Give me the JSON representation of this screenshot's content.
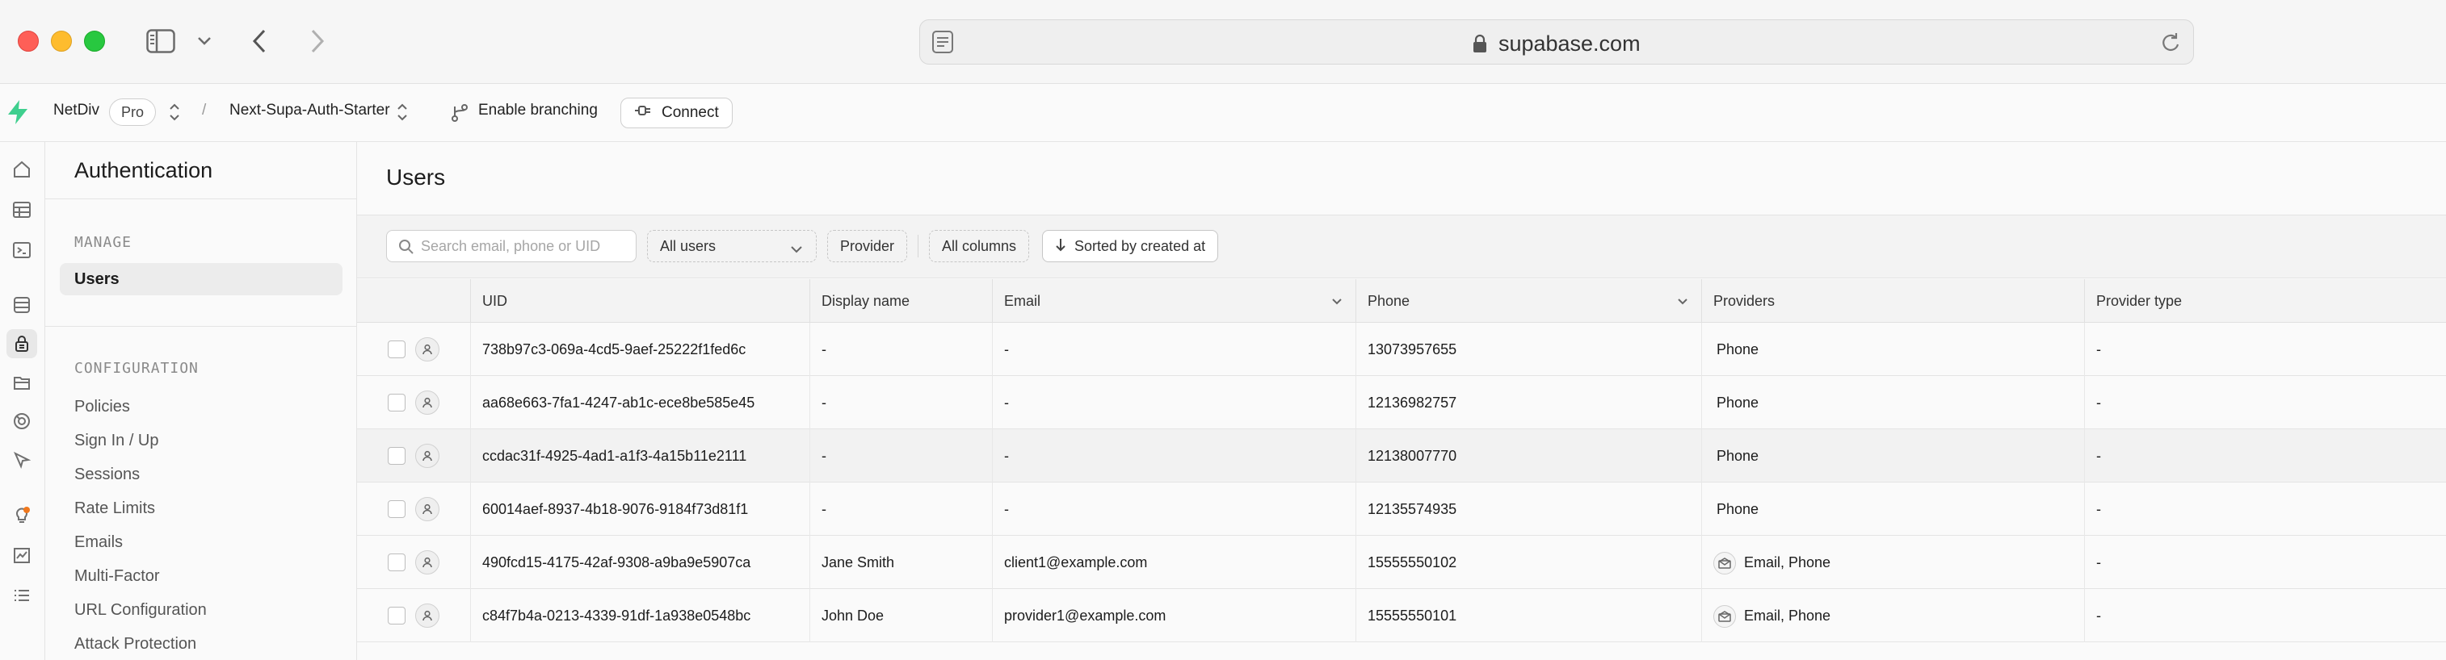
{
  "browser": {
    "url": "supabase.com"
  },
  "header": {
    "org_name": "NetDiv",
    "plan_badge": "Pro",
    "separator": "/",
    "project_name": "Next-Supa-Auth-Starter",
    "branching_label": "Enable branching",
    "connect_label": "Connect"
  },
  "sidebar": {
    "title": "Authentication",
    "manage_heading": "MANAGE",
    "manage_items": [
      {
        "label": "Users"
      }
    ],
    "config_heading": "CONFIGURATION",
    "config_items": [
      {
        "label": "Policies"
      },
      {
        "label": "Sign In / Up"
      },
      {
        "label": "Sessions"
      },
      {
        "label": "Rate Limits"
      },
      {
        "label": "Emails"
      },
      {
        "label": "Multi-Factor"
      },
      {
        "label": "URL Configuration"
      },
      {
        "label": "Attack Protection"
      }
    ]
  },
  "main": {
    "title": "Users",
    "toolbar": {
      "search_placeholder": "Search email, phone or UID",
      "user_filter": "All users",
      "provider_label": "Provider",
      "columns_label": "All columns",
      "sort_label": "Sorted by created at"
    },
    "table": {
      "columns": [
        "UID",
        "Display name",
        "Email",
        "Phone",
        "Providers",
        "Provider type"
      ],
      "rows": [
        {
          "uid": "738b97c3-069a-4cd5-9aef-25222f1fed6c",
          "display_name": "-",
          "email": "-",
          "phone": "13073957655",
          "providers": "Phone",
          "provider_type": "-"
        },
        {
          "uid": "aa68e663-7fa1-4247-ab1c-ece8be585e45",
          "display_name": "-",
          "email": "-",
          "phone": "12136982757",
          "providers": "Phone",
          "provider_type": "-"
        },
        {
          "uid": "ccdac31f-4925-4ad1-a1f3-4a15b11e2111",
          "display_name": "-",
          "email": "-",
          "phone": "12138007770",
          "providers": "Phone",
          "provider_type": "-"
        },
        {
          "uid": "60014aef-8937-4b18-9076-9184f73d81f1",
          "display_name": "-",
          "email": "-",
          "phone": "12135574935",
          "providers": "Phone",
          "provider_type": "-"
        },
        {
          "uid": "490fcd15-4175-42af-9308-a9ba9e5907ca",
          "display_name": "Jane Smith",
          "email": "client1@example.com",
          "phone": "15555550102",
          "providers": "Email, Phone",
          "provider_type": "-"
        },
        {
          "uid": "c84f7b4a-0213-4339-91df-1a938e0548bc",
          "display_name": "John Doe",
          "email": "provider1@example.com",
          "phone": "15555550101",
          "providers": "Email, Phone",
          "provider_type": "-"
        }
      ]
    }
  },
  "colors": {
    "brand_green": "#3ecf8e",
    "accent_orange": "#f0781e"
  }
}
